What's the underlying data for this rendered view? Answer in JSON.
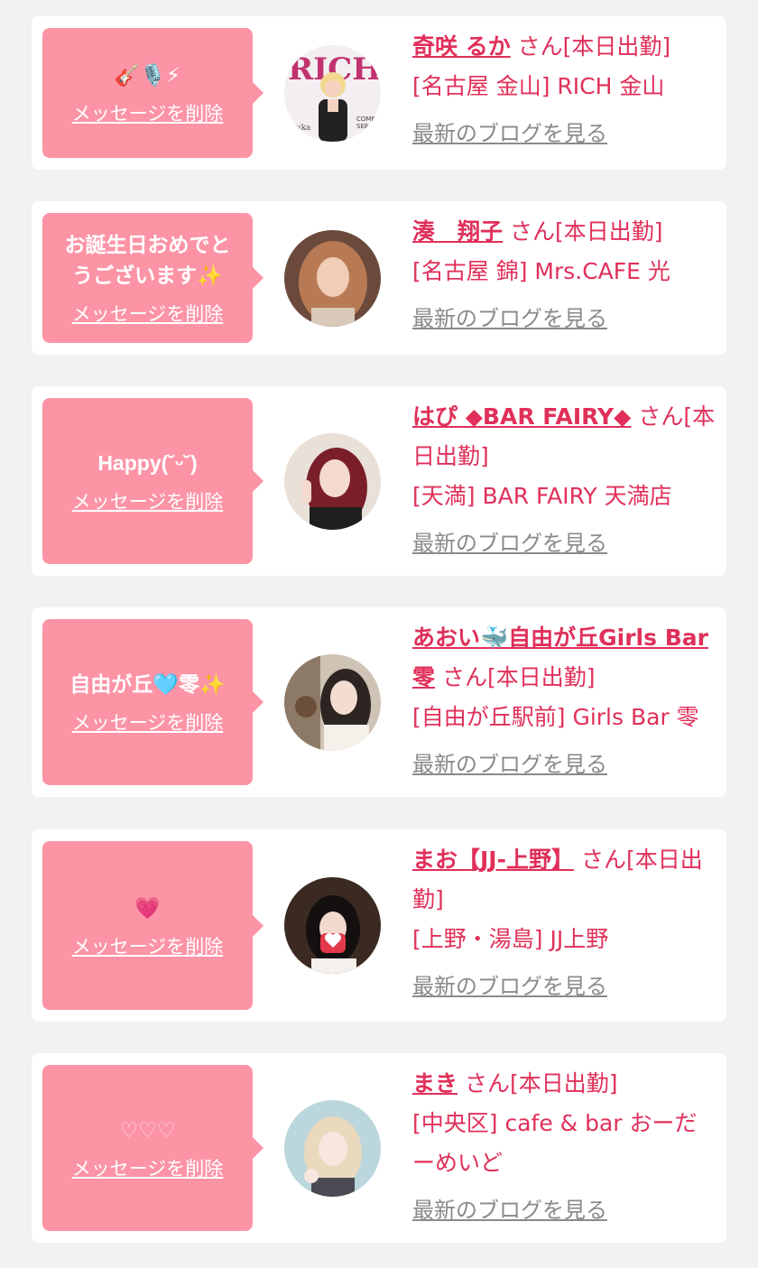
{
  "delete_label": "メッセージを削除",
  "blog_label": "最新のブログを見る",
  "colors": {
    "bubble": "#fc94a6",
    "accent": "#e0305a",
    "blog_link": "#8a8a8a",
    "background": "#f2f2f2"
  },
  "cards": [
    {
      "message": "🎸🎙️⚡",
      "name": "奇咲 るか",
      "status": "さん[本日出勤]",
      "shop": "[名古屋 金山] RICH 金山",
      "avatar_icon": "rich-cover-photo-icon"
    },
    {
      "message": "お誕生日おめでと\nうございます✨",
      "name": "湊　翔子",
      "status": "さん[本日出勤]",
      "shop": "[名古屋 錦] Mrs.CAFE 光",
      "avatar_icon": "profile-photo-icon"
    },
    {
      "message": "Happy(˘ᵕ˘)",
      "name": "はぴ ◆BAR FAIRY◆",
      "status": "さん[本日出勤]",
      "shop": "[天満] BAR FAIRY 天満店",
      "avatar_icon": "profile-photo-icon"
    },
    {
      "message": "自由が丘🩵零✨",
      "name": "あおい🐳自由が丘Girls Bar零",
      "status": "さん[本日出勤]",
      "shop": "[自由が丘駅前] Girls Bar 零",
      "avatar_icon": "profile-photo-icon"
    },
    {
      "message": "💗",
      "name": "まお【JJ-上野】",
      "status": "さん[本日出勤]",
      "shop": "[上野・湯島] JJ上野",
      "avatar_icon": "profile-photo-icon"
    },
    {
      "message": "♡♡♡",
      "name": "まき",
      "status": "さん[本日出勤]",
      "shop": "[中央区] cafe & bar おーだーめいど",
      "avatar_icon": "profile-photo-icon"
    }
  ]
}
